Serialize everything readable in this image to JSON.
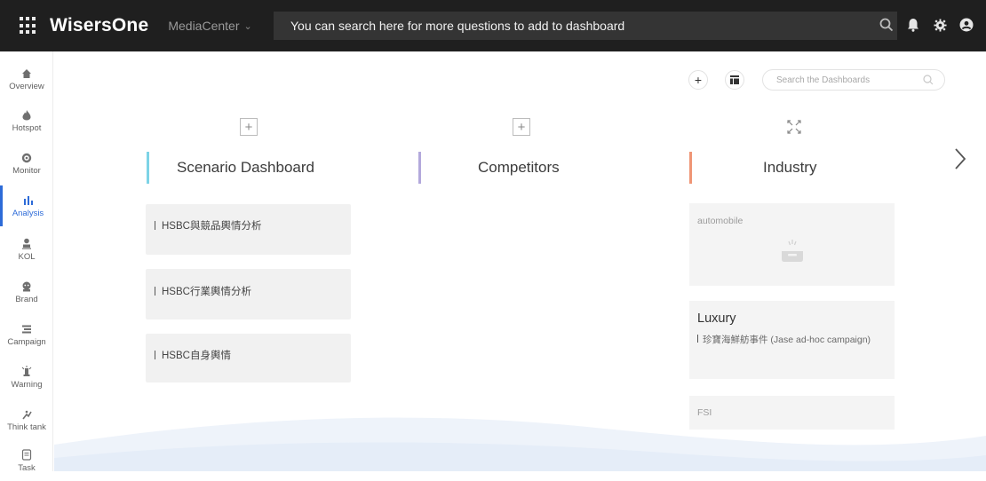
{
  "topbar": {
    "brand": "WisersOne",
    "module": "MediaCenter",
    "search_placeholder": "You can search here for more questions to add to dashboard"
  },
  "sidebar": {
    "items": [
      {
        "label": "Overview",
        "icon": "home-icon"
      },
      {
        "label": "Hotspot",
        "icon": "flame-icon"
      },
      {
        "label": "Monitor",
        "icon": "target-icon"
      },
      {
        "label": "Analysis",
        "icon": "bar-chart-icon",
        "active": true
      },
      {
        "label": "KOL",
        "icon": "person-icon"
      },
      {
        "label": "Brand",
        "icon": "brand-icon"
      },
      {
        "label": "Campaign",
        "icon": "campaign-icon"
      },
      {
        "label": "Warning",
        "icon": "warning-icon"
      },
      {
        "label": "Think tank",
        "icon": "think-tank-icon"
      },
      {
        "label": "Task",
        "icon": "task-icon"
      }
    ]
  },
  "toolbar": {
    "dash_search_placeholder": "Search the Dashboards"
  },
  "columns": {
    "scenario": {
      "title": "Scenario Dashboard",
      "color": "#7dd3e6",
      "cards": [
        "HSBC與競品輿情分析",
        "HSBC行業輿情分析",
        "HSBC自身輿情"
      ]
    },
    "competitors": {
      "title": "Competitors",
      "color": "#b3a9dc"
    },
    "industry": {
      "title": "Industry",
      "color": "#ef9575",
      "cards": {
        "automobile": "automobile",
        "luxury_title": "Luxury",
        "luxury_item": "珍寶海鮮舫事件 (Jase ad-hoc campaign)",
        "fsi": "FSI"
      }
    }
  },
  "colors": {
    "topbar_bg": "#1f1f1f",
    "accent": "#2d6bd8"
  }
}
